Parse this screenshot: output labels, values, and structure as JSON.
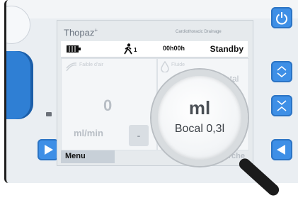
{
  "device": {
    "brand": "Thopaz",
    "brand_mark": "+",
    "subtitle": "Cardiothoracic Drainage"
  },
  "status_bar": {
    "battery_icon": "battery-icon",
    "patient_icon": "walking-person-icon",
    "patient_count": "1",
    "timer": "00h00h",
    "mode": "Standby"
  },
  "panels": {
    "left_label": "Faible d'air",
    "left_value": "0",
    "left_unit": "ml/min",
    "right_label": "Fluide",
    "right_total": "Total",
    "minus": "-"
  },
  "softkeys": {
    "left": "Menu",
    "right": "Marche"
  },
  "magnifier": {
    "unit": "ml",
    "canister": "Bocal 0,3l"
  },
  "colors": {
    "accent_blue": "#3e8fe6",
    "handle_blue": "#2f7fd4",
    "screen_bg": "#e6eaed"
  }
}
